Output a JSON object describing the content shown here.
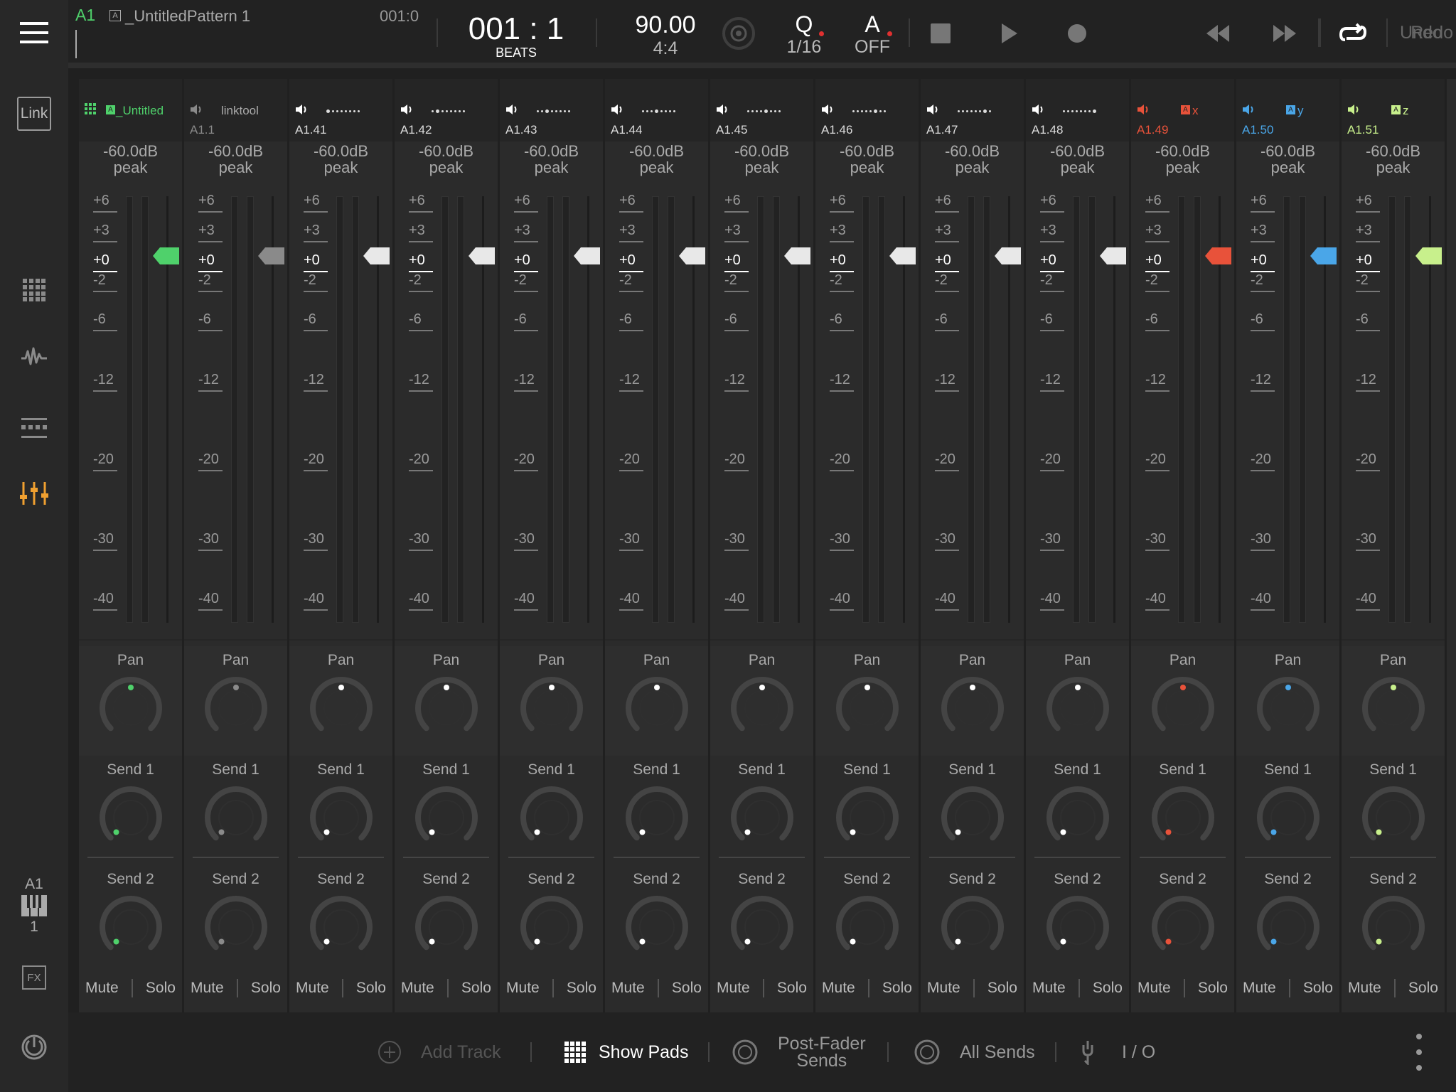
{
  "colors": {
    "accent_green": "#4fd16b",
    "accent_orange": "#e8523a",
    "accent_blue": "#4aa6e8",
    "accent_lime": "#c8f08c",
    "mixer_icon": "#f0a030",
    "sidebar_bg": "#282828",
    "strip_bg": "#2b2b2b"
  },
  "sidebar": {
    "link_label": "Link",
    "track_id": "A1",
    "track_num": "1",
    "fx_label": "FX",
    "icons": [
      "menu-icon",
      "link-icon",
      "pads-grid-icon",
      "waveform-icon",
      "sequencer-icon",
      "mixer-icon",
      "keyboard-icon",
      "fx-icon",
      "power-icon"
    ]
  },
  "topbar": {
    "track_label": "A1",
    "pattern_name": "_UntitledPattern 1",
    "pattern_pos": "001:0",
    "position": "001 : 1",
    "position_unit": "BEATS",
    "tempo": "90.00",
    "signature": "4:4",
    "quantize_label": "Q",
    "quantize_value": "1/16",
    "automation_label": "A",
    "automation_value": "OFF",
    "undo": "Undo",
    "redo": "Redo"
  },
  "mixer": {
    "peak_label": "peak",
    "pan_label": "Pan",
    "send1_label": "Send 1",
    "send2_label": "Send 2",
    "mute_label": "Mute",
    "solo_label": "Solo",
    "scale": [
      "+6",
      "+3",
      "+0",
      "-2",
      "-6",
      "-12",
      "-20",
      "-30",
      "-40"
    ],
    "tracks": [
      {
        "name": "_Untitled",
        "id": "",
        "type": "pattern",
        "color": "#4fd16b",
        "peak": "-60.0dB",
        "dot": -1
      },
      {
        "name": "linktool",
        "id": "A1.1",
        "type": "link",
        "color": "#8a8a8a",
        "peak": "-60.0dB",
        "dot": -1
      },
      {
        "name": "",
        "id": "A1.41",
        "type": "dots",
        "color": "#ffffff",
        "peak": "-60.0dB",
        "dot": 0
      },
      {
        "name": "",
        "id": "A1.42",
        "type": "dots",
        "color": "#ffffff",
        "peak": "-60.0dB",
        "dot": 1
      },
      {
        "name": "",
        "id": "A1.43",
        "type": "dots",
        "color": "#ffffff",
        "peak": "-60.0dB",
        "dot": 2
      },
      {
        "name": "",
        "id": "A1.44",
        "type": "dots",
        "color": "#ffffff",
        "peak": "-60.0dB",
        "dot": 3
      },
      {
        "name": "",
        "id": "A1.45",
        "type": "dots",
        "color": "#ffffff",
        "peak": "-60.0dB",
        "dot": 4
      },
      {
        "name": "",
        "id": "A1.46",
        "type": "dots",
        "color": "#ffffff",
        "peak": "-60.0dB",
        "dot": 5
      },
      {
        "name": "",
        "id": "A1.47",
        "type": "dots",
        "color": "#ffffff",
        "peak": "-60.0dB",
        "dot": 6
      },
      {
        "name": "",
        "id": "A1.48",
        "type": "dots",
        "color": "#ffffff",
        "peak": "-60.0dB",
        "dot": 7
      },
      {
        "name": "x",
        "id": "A1.49",
        "type": "pattern",
        "color": "#e8523a",
        "peak": "-60.0dB",
        "dot": -1
      },
      {
        "name": "y",
        "id": "A1.50",
        "type": "pattern",
        "color": "#4aa6e8",
        "peak": "-60.0dB",
        "dot": -1
      },
      {
        "name": "z",
        "id": "A1.51",
        "type": "pattern",
        "color": "#c8f08c",
        "peak": "-60.0dB",
        "dot": -1
      }
    ]
  },
  "bottombar": {
    "add_track": "Add Track",
    "show_pads": "Show Pads",
    "post_fader_1": "Post-Fader",
    "post_fader_2": "Sends",
    "all_sends": "All Sends",
    "io": "I / O"
  }
}
